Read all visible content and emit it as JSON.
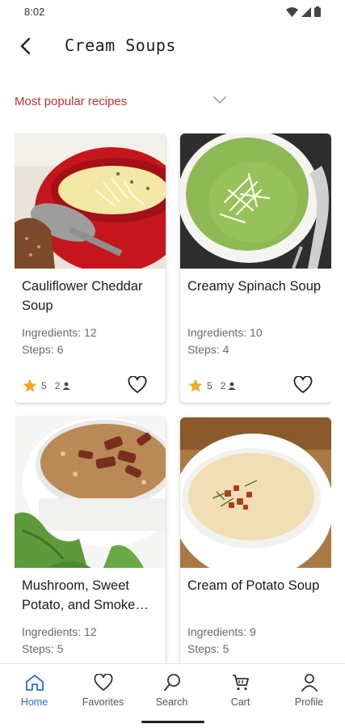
{
  "status_bar": {
    "time": "8:02"
  },
  "header": {
    "title": "Cream Soups"
  },
  "filter": {
    "label": "Most popular recipes"
  },
  "recipes": [
    {
      "title": "Cauliflower Cheddar Soup",
      "ingredients": "Ingredients: 12",
      "steps": "Steps: 6",
      "rating": "5",
      "reviews": "2"
    },
    {
      "title": "Creamy Spinach Soup",
      "ingredients": "Ingredients: 10",
      "steps": "Steps: 4",
      "rating": "5",
      "reviews": "2"
    },
    {
      "title": "Mushroom, Sweet Potato, and Smoke…",
      "ingredients": "Ingredients: 12",
      "steps": "Steps: 5"
    },
    {
      "title": "Cream of Potato Soup",
      "ingredients": "Ingredients: 9",
      "steps": "Steps: 5"
    }
  ],
  "nav": {
    "items": [
      {
        "label": "Home",
        "active": true
      },
      {
        "label": "Favorites"
      },
      {
        "label": "Search"
      },
      {
        "label": "Cart"
      },
      {
        "label": "Profile"
      }
    ]
  },
  "colors": {
    "accent": "#d32f2f",
    "active_nav": "#2a6fd6",
    "star": "#f5a623"
  }
}
